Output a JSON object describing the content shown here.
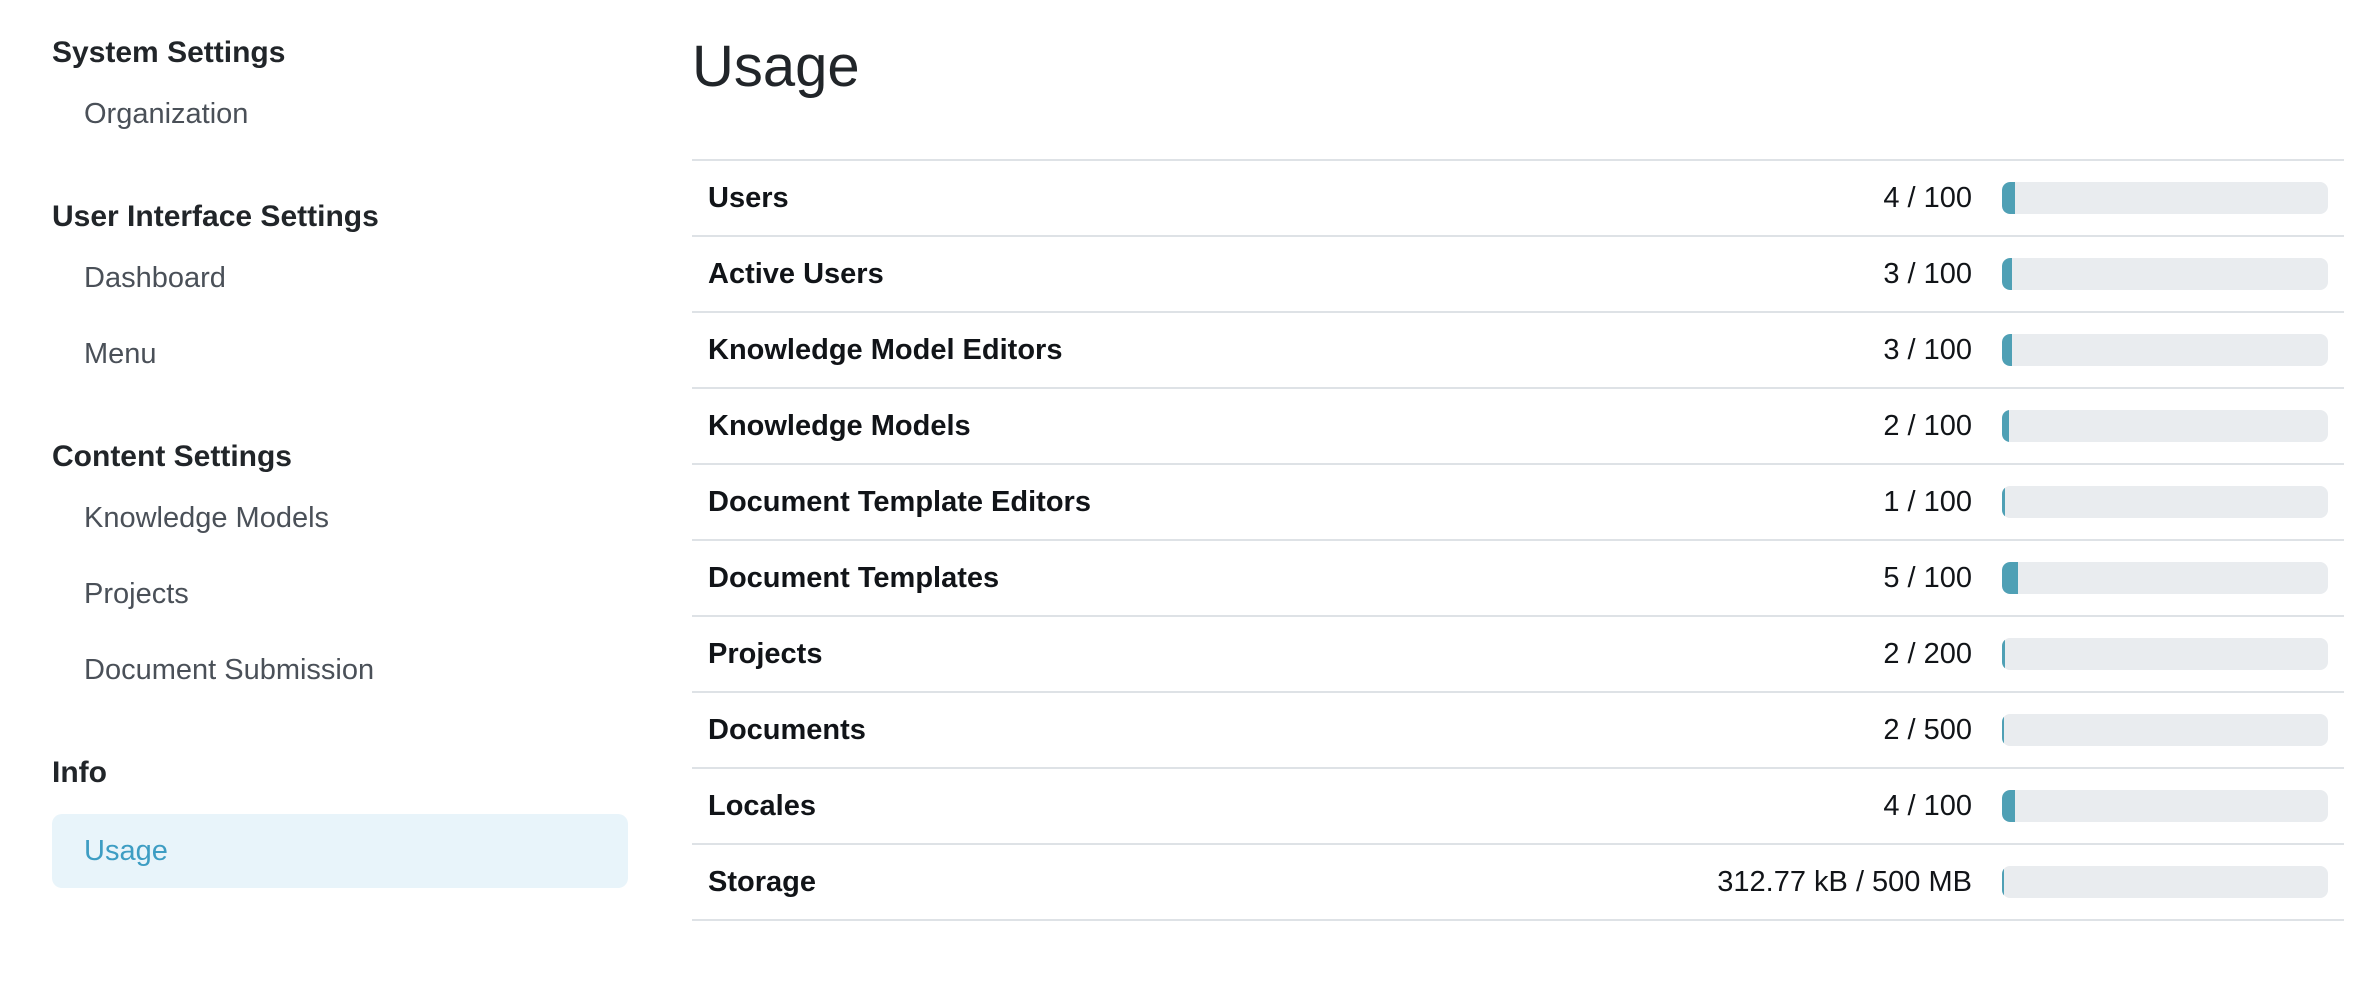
{
  "sidebar": {
    "sections": [
      {
        "title": "System Settings",
        "items": [
          "Organization"
        ]
      },
      {
        "title": "User Interface Settings",
        "items": [
          "Dashboard",
          "Menu"
        ]
      },
      {
        "title": "Content Settings",
        "items": [
          "Knowledge Models",
          "Projects",
          "Document Submission"
        ]
      },
      {
        "title": "Info",
        "items": [
          "Usage"
        ]
      }
    ],
    "active_item": "Usage"
  },
  "main": {
    "title": "Usage",
    "rows": [
      {
        "label": "Users",
        "value": "4 / 100",
        "fraction": 0.04
      },
      {
        "label": "Active Users",
        "value": "3 / 100",
        "fraction": 0.03
      },
      {
        "label": "Knowledge Model Editors",
        "value": "3 / 100",
        "fraction": 0.03
      },
      {
        "label": "Knowledge Models",
        "value": "2 / 100",
        "fraction": 0.02
      },
      {
        "label": "Document Template Editors",
        "value": "1 / 100",
        "fraction": 0.01
      },
      {
        "label": "Document Templates",
        "value": "5 / 100",
        "fraction": 0.05
      },
      {
        "label": "Projects",
        "value": "2 / 200",
        "fraction": 0.01
      },
      {
        "label": "Documents",
        "value": "2 / 500",
        "fraction": 0.004
      },
      {
        "label": "Locales",
        "value": "4 / 100",
        "fraction": 0.04
      },
      {
        "label": "Storage",
        "value": "312.77 kB / 500 MB",
        "fraction": 0.0006
      }
    ]
  },
  "colors": {
    "accent": "#3d9dc3",
    "active_bg": "#e8f4fa",
    "bar_fill": "#4fa0b5",
    "bar_track": "#e9ecef"
  }
}
